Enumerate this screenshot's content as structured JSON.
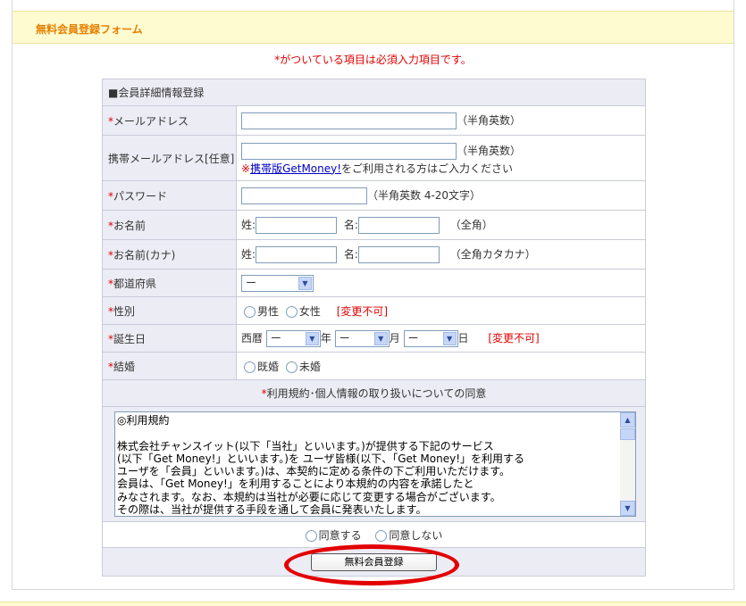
{
  "header": {
    "title": "無料会員登録フォーム"
  },
  "required_note": {
    "star": "*",
    "text": "がついている項目は必須入力項目です。"
  },
  "section": {
    "title": "■会員詳細情報登録"
  },
  "fields": {
    "email": {
      "star": "*",
      "label": "メールアドレス",
      "value": "",
      "hint": "（半角英数）"
    },
    "mobile_email": {
      "label": "携帯メールアドレス[任意]",
      "value": "",
      "hint": "（半角英数）",
      "note_prefix": "※",
      "note_link": "携帯版GetMoney!",
      "note_suffix": "をご利用される方はご入力ください"
    },
    "password": {
      "star": "*",
      "label": "パスワード",
      "value": "",
      "hint": "（半角英数 4-20文字）"
    },
    "name": {
      "star": "*",
      "label": "お名前",
      "sei_label": "姓:",
      "mei_label": "名:",
      "sei_value": "",
      "mei_value": "",
      "hint": "（全角）"
    },
    "name_kana": {
      "star": "*",
      "label": "お名前(カナ)",
      "sei_label": "姓:",
      "mei_label": "名:",
      "sei_value": "",
      "mei_value": "",
      "hint": "（全角カタカナ）"
    },
    "prefecture": {
      "star": "*",
      "label": "都道府県",
      "selected": "ー"
    },
    "gender": {
      "star": "*",
      "label": "性別",
      "options": [
        "男性",
        "女性"
      ],
      "notice": "[変更不可]"
    },
    "birthday": {
      "star": "*",
      "label": "誕生日",
      "era_label": "西暦",
      "year_selected": "ー",
      "year_unit": "年",
      "month_selected": "ー",
      "month_unit": "月",
      "day_selected": "ー",
      "day_unit": "日",
      "notice": "[変更不可]"
    },
    "marriage": {
      "star": "*",
      "label": "結婚",
      "options": [
        "既婚",
        "未婚"
      ]
    }
  },
  "agreement": {
    "star": "*",
    "title": "利用規約･個人情報の取り扱いについての同意",
    "terms_text": "◎利用規約\n\n株式会社チャンスイット(以下「当社」といいます。)が提供する下記のサービス\n(以下「Get Money!」といいます。)を ユーザ皆様(以下、「Get Money!」を利用する\nユーザを「会員」といいます。)は、本契約に定める条件の下ご利用いただけます。\n会員は、「Get Money!」を利用することにより本規約の内容を承諾したと\nみなされます。なお、本規約は当社が必要に応じて変更する場合がございます。\nその際は、当社が提供する手段を通して会員に発表いたします。",
    "agree_label": "同意する",
    "disagree_label": "同意しない"
  },
  "submit": {
    "label": "無料会員登録"
  },
  "colors": {
    "accent": "#e68000",
    "required": "#e00000",
    "highlight": "#e30000"
  },
  "icons": {
    "dropdown": "chevron-down-icon",
    "scroll_up": "arrow-up-icon",
    "scroll_down": "arrow-down-icon"
  }
}
